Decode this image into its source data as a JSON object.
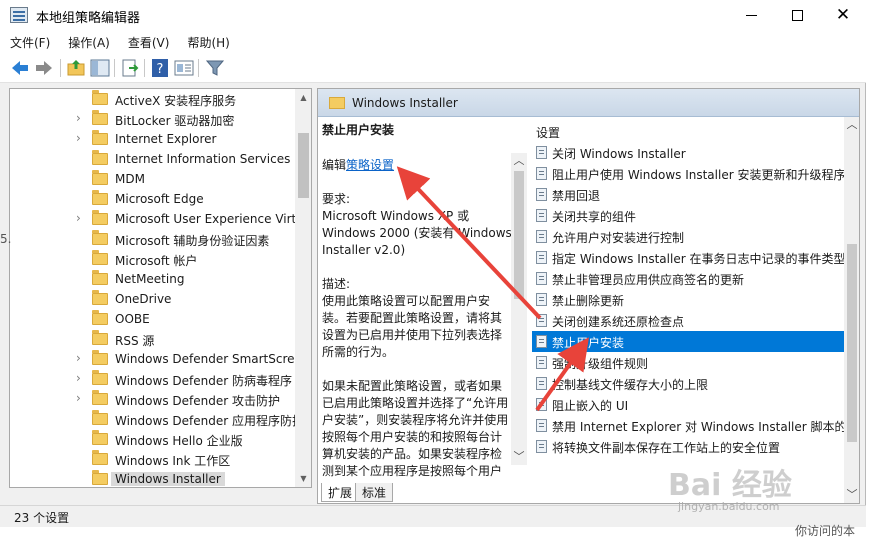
{
  "window": {
    "title": "本地组策略编辑器",
    "close_glyph": "✕"
  },
  "menu": [
    "文件(F)",
    "操作(A)",
    "查看(V)",
    "帮助(H)"
  ],
  "tree": {
    "items": [
      {
        "label": "ActiveX 安装程序服务",
        "expandable": false
      },
      {
        "label": "BitLocker 驱动器加密",
        "expandable": true
      },
      {
        "label": "Internet Explorer",
        "expandable": true
      },
      {
        "label": "Internet Information Services",
        "expandable": false
      },
      {
        "label": "MDM",
        "expandable": false
      },
      {
        "label": "Microsoft Edge",
        "expandable": false
      },
      {
        "label": "Microsoft User Experience Virt",
        "expandable": true
      },
      {
        "label": "Microsoft 辅助身份验证因素",
        "expandable": false
      },
      {
        "label": "Microsoft 帐户",
        "expandable": false
      },
      {
        "label": "NetMeeting",
        "expandable": false
      },
      {
        "label": "OneDrive",
        "expandable": false
      },
      {
        "label": "OOBE",
        "expandable": false
      },
      {
        "label": "RSS 源",
        "expandable": false
      },
      {
        "label": "Windows Defender SmartScree",
        "expandable": true
      },
      {
        "label": "Windows Defender 防病毒程序",
        "expandable": true
      },
      {
        "label": "Windows Defender 攻击防护",
        "expandable": true
      },
      {
        "label": "Windows Defender 应用程序防护",
        "expandable": false
      },
      {
        "label": "Windows Hello 企业版",
        "expandable": false
      },
      {
        "label": "Windows Ink 工作区",
        "expandable": false
      },
      {
        "label": "Windows Installer",
        "expandable": false,
        "selected": true
      }
    ]
  },
  "right_pane": {
    "header": "Windows Installer",
    "policy_title": "禁止用户安装",
    "edit_prefix": "编辑",
    "edit_link": "策略设置",
    "requirements_label": "要求:",
    "requirements_text": "Microsoft Windows XP 或 Windows 2000 (安装有 Windows Installer v2.0)",
    "description_label": "描述:",
    "description_1": "使用此策略设置可以配置用户安装。若要配置此策略设置，请将其设置为已启用并使用下拉列表选择所需的行为。",
    "description_2": "如果未配置此策略设置，或者如果已启用此策略设置并选择了“允许用户安装”，则安装程序将允许并使用按照每个用户安装的和按照每台计算机安装的产品。如果安装程序检测到某个应用程序是按照每个用户"
  },
  "settings": {
    "column_header": "设置",
    "items": [
      "关闭 Windows Installer",
      "阻止用户使用 Windows Installer 安装更新和升级程序",
      "禁用回退",
      "关闭共享的组件",
      "允许用户对安装进行控制",
      "指定 Windows Installer 在事务日志中记录的事件类型",
      "禁止非管理员应用供应商签名的更新",
      "禁止删除更新",
      "关闭创建系统还原检查点",
      "禁止用户安装",
      "强制升级组件规则",
      "控制基线文件缓存大小的上限",
      "阻止嵌入的 UI",
      "禁用 Internet Explorer 对 Windows Installer 脚本的安",
      "将转换文件副本保存在工作站上的安全位置"
    ],
    "selected_index": 9
  },
  "tabs": [
    "扩展",
    "标准"
  ],
  "status": "23 个设置",
  "background": {
    "left_fragment": "5.",
    "bottom_right": "你访问的本"
  },
  "watermark": {
    "main": "Bai 经验",
    "sub": "jingyan.baidu.com"
  },
  "colors": {
    "selection": "#0078d7",
    "link": "#0b63c8",
    "annotation_arrow": "#e8433a"
  },
  "icons": {
    "back": "back-arrow-icon",
    "forward": "forward-arrow-icon",
    "up": "up-folder-icon",
    "show_hide": "show-hide-tree-icon",
    "export": "export-list-icon",
    "help": "help-icon",
    "extended": "extended-view-icon",
    "filter": "filter-icon"
  }
}
